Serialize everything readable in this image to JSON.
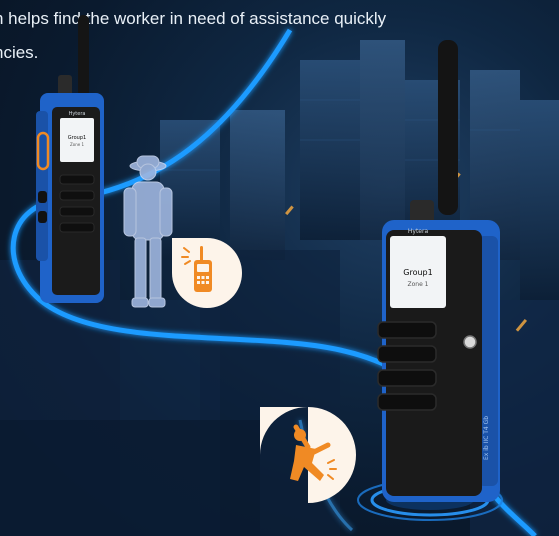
{
  "caption": {
    "line1": "n helps find the worker in need of assistance quickly",
    "line2": "ncies."
  },
  "left_radio": {
    "brand": "Hytera",
    "screen_group": "Group1",
    "screen_zone": "Zone 1"
  },
  "right_radio": {
    "brand": "Hytera",
    "screen_group": "Group1",
    "screen_zone": "Zone 1",
    "side_label": "Ex ib IIC T4 Gb"
  },
  "icons": {
    "radio_badge": "radio-icon",
    "fall_badge": "falling-person-icon"
  },
  "colors": {
    "path_glow": "#1e9bff",
    "radio_blue": "#1f63c9",
    "badge_orange": "#f08a24",
    "badge_bg": "#fdf4ea"
  }
}
